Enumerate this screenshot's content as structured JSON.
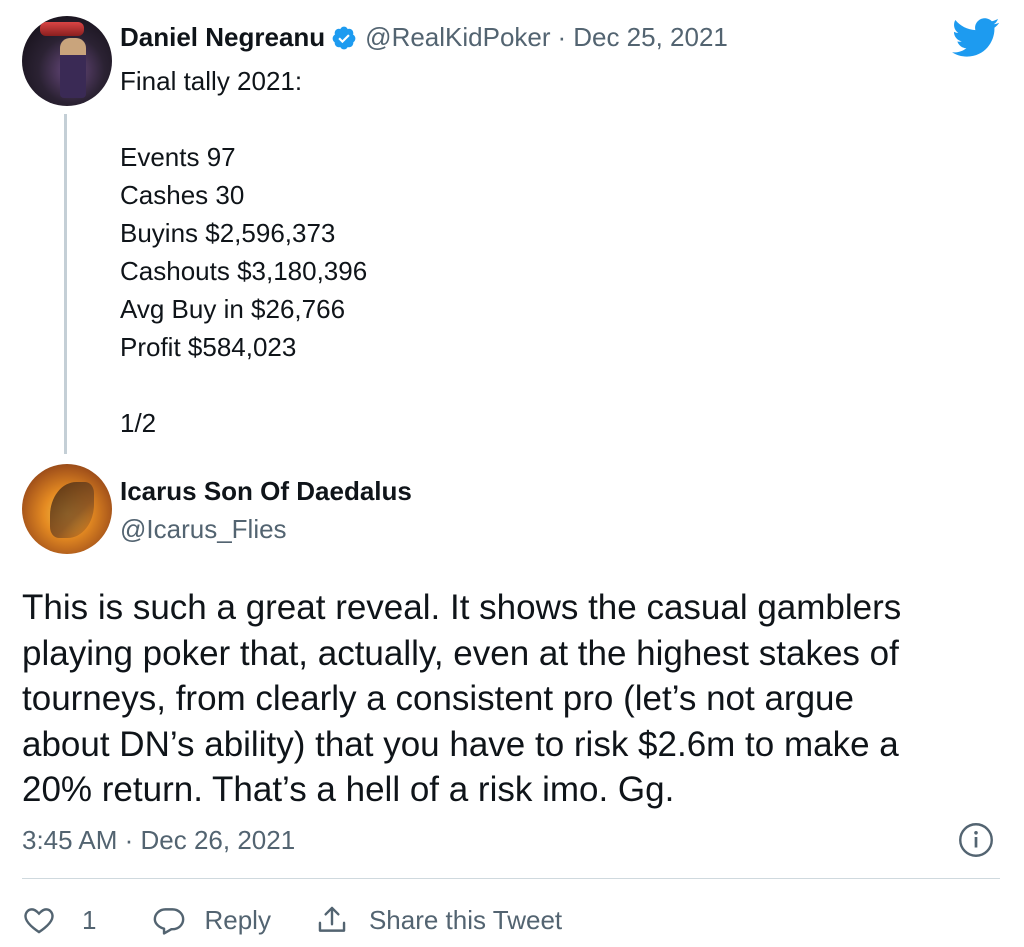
{
  "parent_tweet": {
    "author_name": "Daniel Negreanu",
    "handle": "@RealKidPoker",
    "separator": "·",
    "date": "Dec 25, 2021",
    "avatar_icon": "avatar-photo",
    "verified_icon": "verified-badge-icon",
    "lines": [
      "Final tally 2021:",
      "Events 97",
      "Cashes 30",
      "Buyins $2,596,373",
      "Cashouts $3,180,396",
      "Avg Buy in $26,766",
      "Profit $584,023",
      "1/2"
    ]
  },
  "reply_tweet": {
    "author_name": "Icarus Son Of Daedalus",
    "handle": "@Icarus_Flies",
    "body_lines": [
      "This is such a great reveal. It shows the casual gamblers",
      "playing poker that, actually, even at the highest stakes of",
      "tourneys, from clearly a consistent pro (let’s not argue",
      "about DN’s ability) that you have to risk $2.6m to make a",
      "20% return. That’s a hell of a risk imo. Gg."
    ],
    "timestamp": "3:45 AM · Dec 26, 2021"
  },
  "actions": {
    "like_count": "1",
    "reply_label": "Reply",
    "share_label": "Share this Tweet"
  },
  "colors": {
    "twitter_blue": "#1d9bf0",
    "secondary_text": "#536471",
    "thread_line": "#c4cfd6",
    "divider": "#cfd9de"
  }
}
